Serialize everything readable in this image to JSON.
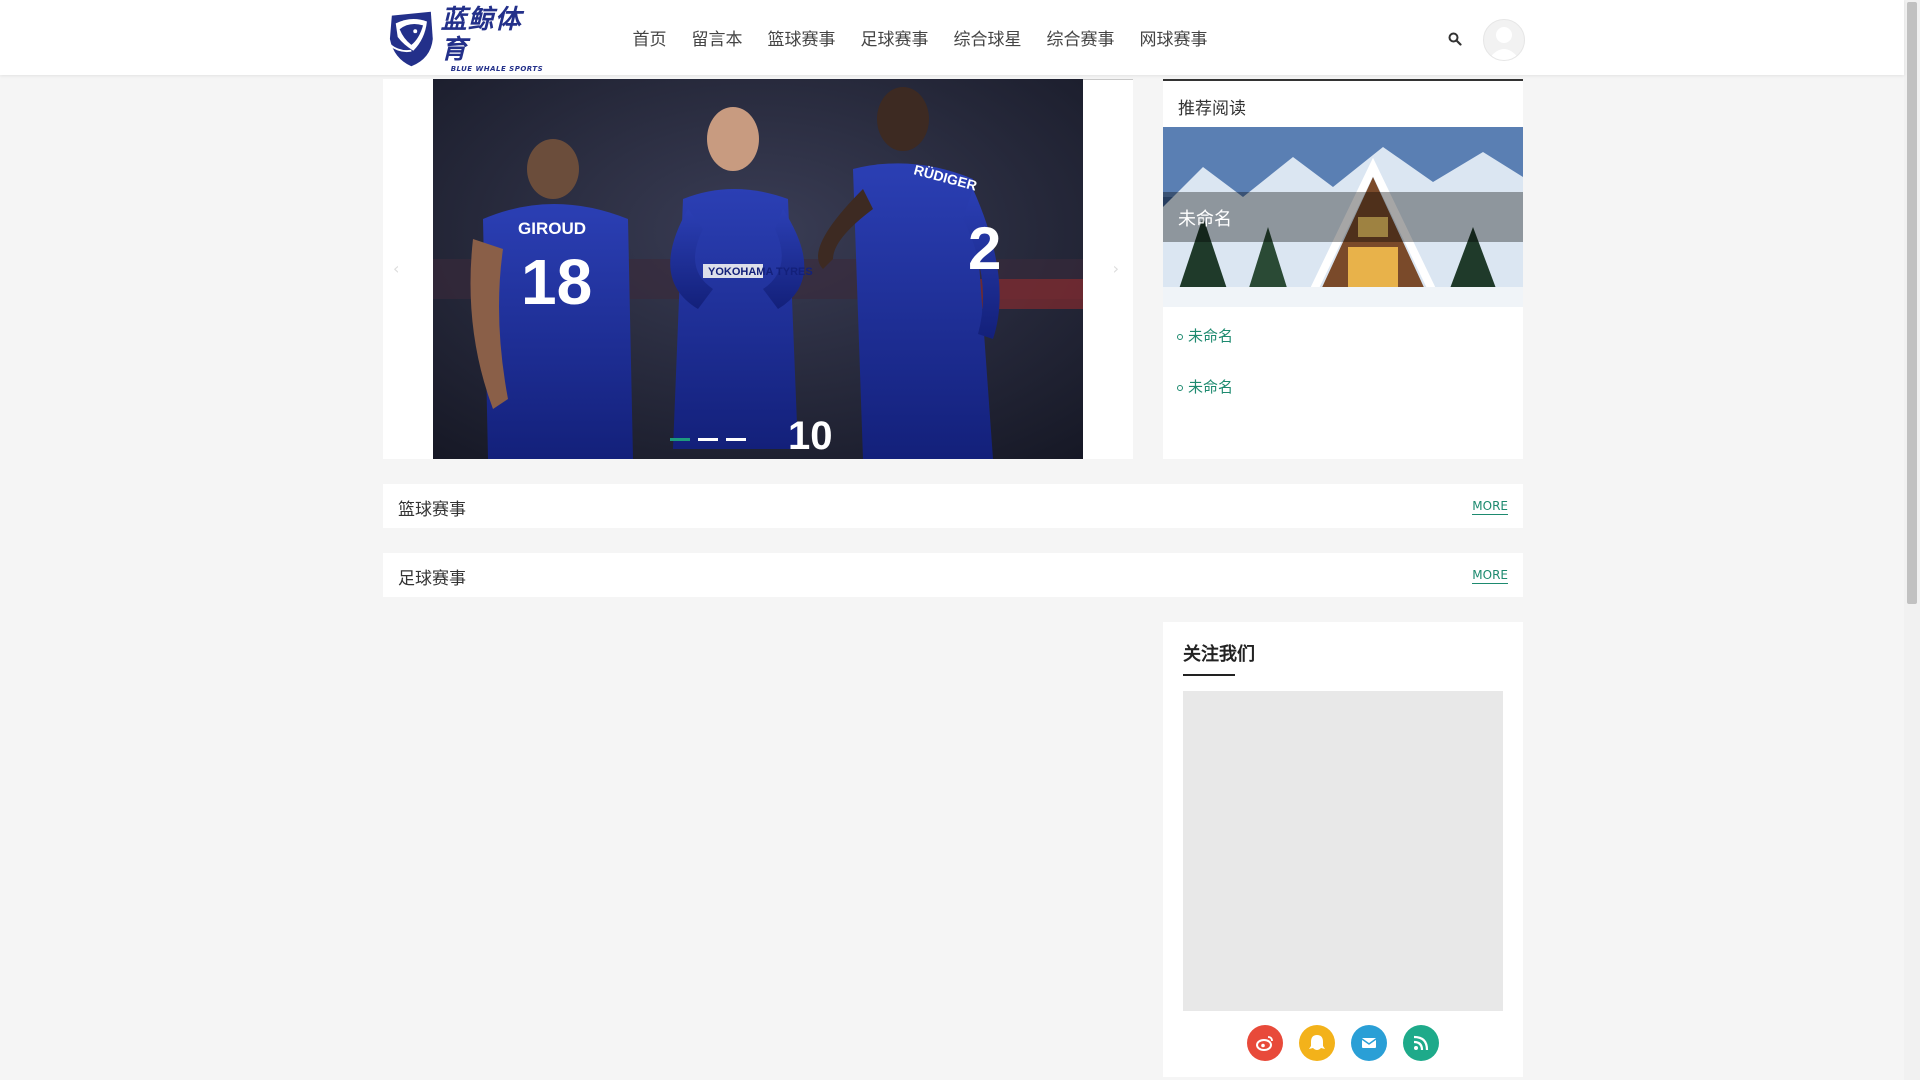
{
  "header": {
    "logo_cn": "蓝鲸体育",
    "logo_en": "BLUE WHALE SPORTS",
    "nav": [
      "首页",
      "留言本",
      "篮球赛事",
      "足球赛事",
      "综合球星",
      "综合赛事",
      "网球赛事"
    ],
    "search_icon": "search-icon",
    "avatar_icon": "user-avatar-icon"
  },
  "carousel": {
    "prev_label": "‹",
    "next_label": "›",
    "slides": 3,
    "active_slide": 1,
    "jersey_texts": [
      "GIROUD",
      "18",
      "YOKOHAMA TYRES",
      "RÜDIGER",
      "2",
      "10"
    ]
  },
  "recommend": {
    "title": "推荐阅读",
    "featured": "未命名",
    "links": [
      "未命名",
      "未命名"
    ]
  },
  "sections": [
    {
      "title": "篮球赛事",
      "more": "MORE"
    },
    {
      "title": "足球赛事",
      "more": "MORE"
    }
  ],
  "follow": {
    "title": "关注我们",
    "socials": [
      {
        "icon": "weibo-icon",
        "color": "#e84a3a"
      },
      {
        "icon": "qq-icon",
        "color": "#f3b21a"
      },
      {
        "icon": "email-icon",
        "color": "#2a9fd6"
      },
      {
        "icon": "rss-icon",
        "color": "#1eaa8a"
      }
    ]
  },
  "colors": {
    "accent": "#1d8a6f",
    "brand": "#23308a"
  }
}
